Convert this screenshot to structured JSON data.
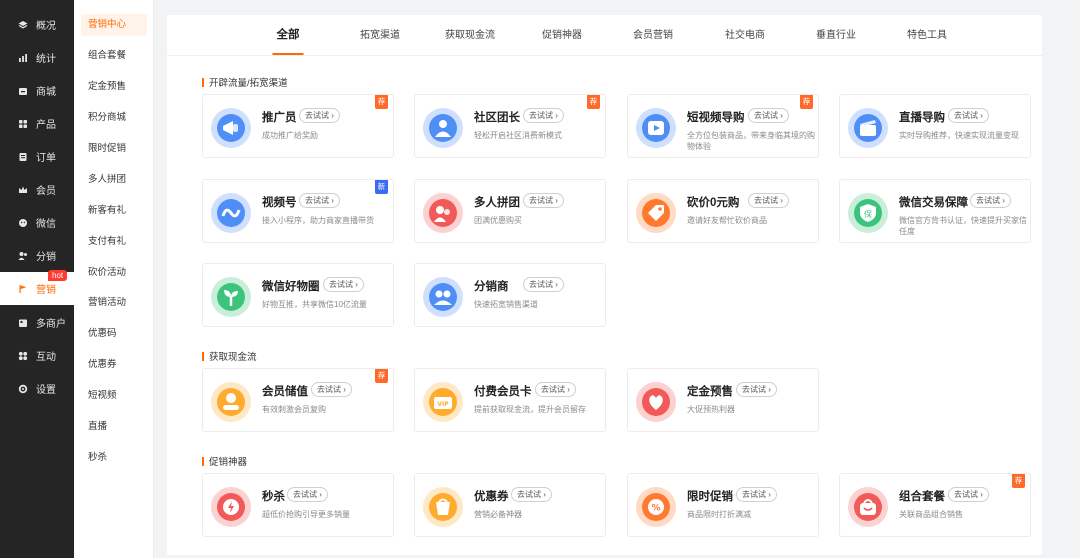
{
  "nav": {
    "items": [
      {
        "label": "概况",
        "icon": "layers-icon"
      },
      {
        "label": "统计",
        "icon": "chart-icon"
      },
      {
        "label": "商城",
        "icon": "store-icon"
      },
      {
        "label": "产品",
        "icon": "grid-icon"
      },
      {
        "label": "订单",
        "icon": "order-icon"
      },
      {
        "label": "会员",
        "icon": "crown-icon"
      },
      {
        "label": "微信",
        "icon": "wechat-icon"
      },
      {
        "label": "分销",
        "icon": "users-icon"
      },
      {
        "label": "营销",
        "icon": "flag-icon"
      },
      {
        "label": "多商户",
        "icon": "shop-icon"
      },
      {
        "label": "互动",
        "icon": "apps-icon"
      },
      {
        "label": "设置",
        "icon": "gear-icon"
      }
    ],
    "hot_badge": "hot",
    "active_color": "#ff6a00"
  },
  "subnav": {
    "items": [
      "营销中心",
      "组合套餐",
      "定金预售",
      "积分商城",
      "限时促销",
      "多人拼团",
      "新客有礼",
      "支付有礼",
      "砍价活动",
      "营销活动",
      "优惠码",
      "优惠券",
      "短视频",
      "直播",
      "秒杀"
    ]
  },
  "tabs": [
    "全部",
    "拓宽渠道",
    "获取现金流",
    "促销神器",
    "会员营销",
    "社交电商",
    "垂直行业",
    "特色工具"
  ],
  "try_label": "去试试",
  "sections": {
    "s1": "开辟流量/拓宽渠道",
    "s2": "获取现金流",
    "s3": "促销神器"
  },
  "cards": [
    {
      "title": "推广员",
      "desc": "成功推广给奖励",
      "badge": "荐",
      "badge_type": "rec",
      "icon": "megaphone-icon",
      "color": "#4f8ef7"
    },
    {
      "title": "社区团长",
      "desc": "轻松开启社区消费新模式",
      "badge": "荐",
      "badge_type": "rec",
      "icon": "community-leader-icon",
      "color": "#4f8ef7"
    },
    {
      "title": "短视频导购",
      "desc": "全方位包装商品，带来身临其境的购物体验",
      "badge": "荐",
      "badge_type": "rec",
      "icon": "short-video-icon",
      "color": "#4f8ef7"
    },
    {
      "title": "直播导购",
      "desc": "实时导购推荐，快速实现流量变现",
      "badge": "",
      "badge_type": "",
      "icon": "clapper-icon",
      "color": "#4f8ef7"
    },
    {
      "title": "视频号",
      "desc": "接入小程序，助力商家直播带货",
      "badge": "新",
      "badge_type": "new",
      "icon": "channels-icon",
      "color": "#4f8ef7"
    },
    {
      "title": "多人拼团",
      "desc": "团满优惠购买",
      "badge": "",
      "badge_type": "",
      "icon": "group-buy-icon",
      "color": "#f25a5a"
    },
    {
      "title": "砍价0元购",
      "desc": "邀请好友帮忙砍价商品",
      "badge": "",
      "badge_type": "",
      "icon": "price-tag-icon",
      "color": "#ff7a2e"
    },
    {
      "title": "微信交易保障",
      "desc": "微信官方背书认证，快速提升买家信任度",
      "badge": "",
      "badge_type": "",
      "icon": "shield-icon",
      "color": "#3cc47c"
    },
    {
      "title": "微信好物圈",
      "desc": "好物互推，共享微信10亿流量",
      "badge": "",
      "badge_type": "",
      "icon": "sprout-icon",
      "color": "#3cc47c"
    },
    {
      "title": "分销商",
      "desc": "快速拓宽销售渠道",
      "badge": "",
      "badge_type": "",
      "icon": "distributor-icon",
      "color": "#4f8ef7"
    },
    {
      "title": "会员储值",
      "desc": "有效刺激会员复购",
      "badge": "荐",
      "badge_type": "rec",
      "icon": "coin-stack-icon",
      "color": "#ffab2e"
    },
    {
      "title": "付费会员卡",
      "desc": "提前获取现金流，提升会员留存",
      "badge": "",
      "badge_type": "",
      "icon": "vip-card-icon",
      "color": "#ffab2e"
    },
    {
      "title": "定金预售",
      "desc": "大促预热利器",
      "badge": "",
      "badge_type": "",
      "icon": "presale-icon",
      "color": "#f25a5a"
    },
    {
      "title": "秒杀",
      "desc": "超低价抢购引导更多销量",
      "badge": "",
      "badge_type": "",
      "icon": "flash-sale-icon",
      "color": "#f25a5a"
    },
    {
      "title": "优惠券",
      "desc": "营销必备神器",
      "badge": "",
      "badge_type": "",
      "icon": "coupon-icon",
      "color": "#ffab2e"
    },
    {
      "title": "限时促销",
      "desc": "商品限时打折满减",
      "badge": "",
      "badge_type": "",
      "icon": "discount-icon",
      "color": "#ff7a2e"
    },
    {
      "title": "组合套餐",
      "desc": "关联商品组合销售",
      "badge": "荐",
      "badge_type": "rec",
      "icon": "bundle-bag-icon",
      "color": "#f25a5a"
    }
  ]
}
